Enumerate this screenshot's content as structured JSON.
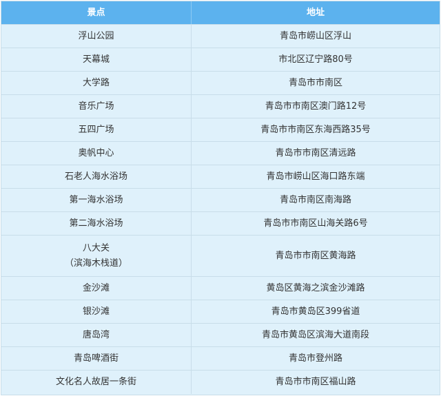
{
  "table": {
    "headers": [
      "景点",
      "地址"
    ],
    "rows": [
      {
        "name": "浮山公园",
        "address": "青岛市崂山区浮山"
      },
      {
        "name": "天幕城",
        "address": "市北区辽宁路80号"
      },
      {
        "name": "大学路",
        "address": "青岛市市南区"
      },
      {
        "name": "音乐广场",
        "address": "青岛市市南区澳门路12号"
      },
      {
        "name": "五四广场",
        "address": "青岛市市南区东海西路35号"
      },
      {
        "name": "奥帆中心",
        "address": "青岛市市南区清远路"
      },
      {
        "name": "石老人海水浴场",
        "address": "青岛市崂山区海口路东端"
      },
      {
        "name": "第一海水浴场",
        "address": "青岛市南区南海路"
      },
      {
        "name": "第二海水浴场",
        "address": "青岛市市南区山海关路6号"
      },
      {
        "name": "八大关",
        "name_line2": "（滨海木栈道）",
        "address": "青岛市市南区黄海路"
      },
      {
        "name": "金沙滩",
        "address": "黄岛区黄海之滨金沙滩路"
      },
      {
        "name": "银沙滩",
        "address": "青岛市黄岛区399省道"
      },
      {
        "name": "唐岛湾",
        "address": "青岛市黄岛区滨海大道南段"
      },
      {
        "name": "青岛啤酒街",
        "address": "青岛市登州路"
      },
      {
        "name": "文化名人故居一条街",
        "address": "青岛市市南区福山路"
      }
    ]
  },
  "colors": {
    "header_bg": "#5cb2ee",
    "row_bg": "#dff1fb",
    "border": "#c8dde9",
    "text": "#333333"
  }
}
